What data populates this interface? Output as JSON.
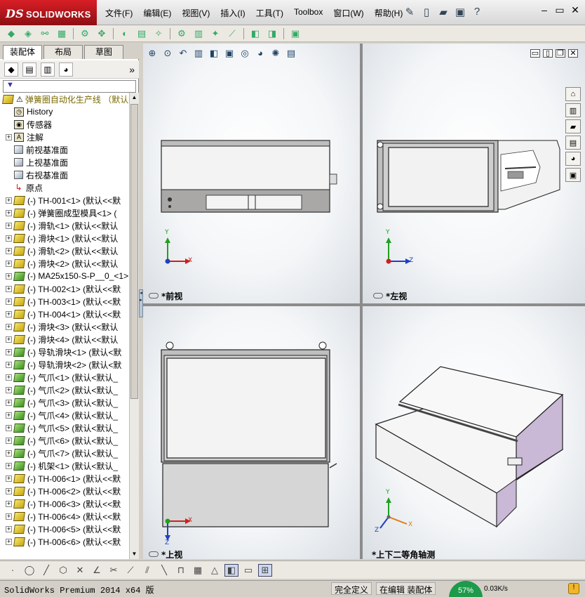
{
  "app": {
    "brand": "SOLIDWORKS",
    "brand_prefix": "DS"
  },
  "menu": [
    {
      "label": "文件(F)"
    },
    {
      "label": "编辑(E)"
    },
    {
      "label": "视图(V)"
    },
    {
      "label": "插入(I)"
    },
    {
      "label": "工具(T)"
    },
    {
      "label": "Toolbox"
    },
    {
      "label": "窗口(W)"
    },
    {
      "label": "帮助(H)"
    }
  ],
  "left_panel": {
    "tabs": [
      {
        "label": "装配体",
        "active": true
      },
      {
        "label": "布局",
        "active": false
      },
      {
        "label": "草图",
        "active": false
      }
    ],
    "filter_icon": "funnel-icon"
  },
  "tree": {
    "root": {
      "label": "弹簧圈自动化生产线 （默认"
    },
    "items": [
      {
        "label": "History",
        "icon": "history",
        "expand": false
      },
      {
        "label": "传感器",
        "icon": "sensor",
        "expand": false
      },
      {
        "label": "注解",
        "icon": "annotation",
        "expand": true
      },
      {
        "label": "前视基准面",
        "icon": "plane",
        "expand": false
      },
      {
        "label": "上视基准面",
        "icon": "plane",
        "expand": false
      },
      {
        "label": "右视基准面",
        "icon": "plane",
        "expand": false
      },
      {
        "label": "原点",
        "icon": "origin",
        "expand": false
      },
      {
        "label": "(-) TH-001<1> (默认<<默",
        "icon": "part",
        "expand": true
      },
      {
        "label": "(-) 弹簧圈成型模具<1> (",
        "icon": "part",
        "expand": true
      },
      {
        "label": "(-) 滑轨<1> (默认<<默认",
        "icon": "part",
        "expand": true
      },
      {
        "label": "(-) 滑块<1> (默认<<默认",
        "icon": "part",
        "expand": true
      },
      {
        "label": "(-) 滑轨<2> (默认<<默认",
        "icon": "part",
        "expand": true
      },
      {
        "label": "(-) 滑块<2> (默认<<默认",
        "icon": "part",
        "expand": true
      },
      {
        "label": "(-) MA25x150-S-P__0_<1>",
        "icon": "part-green",
        "expand": true
      },
      {
        "label": "(-) TH-002<1> (默认<<默",
        "icon": "part",
        "expand": true
      },
      {
        "label": "(-) TH-003<1> (默认<<默",
        "icon": "part",
        "expand": true
      },
      {
        "label": "(-) TH-004<1> (默认<<默",
        "icon": "part",
        "expand": true
      },
      {
        "label": "(-) 滑块<3> (默认<<默认",
        "icon": "part",
        "expand": true
      },
      {
        "label": "(-) 滑块<4> (默认<<默认",
        "icon": "part",
        "expand": true
      },
      {
        "label": "(-) 导轨滑块<1> (默认<默",
        "icon": "part-green",
        "expand": true
      },
      {
        "label": "(-) 导轨滑块<2> (默认<默",
        "icon": "part-green",
        "expand": true
      },
      {
        "label": "(-) 气爪<1> (默认<默认_",
        "icon": "part-green",
        "expand": true
      },
      {
        "label": "(-) 气爪<2> (默认<默认_",
        "icon": "part-green",
        "expand": true
      },
      {
        "label": "(-) 气爪<3> (默认<默认_",
        "icon": "part-green",
        "expand": true
      },
      {
        "label": "(-) 气爪<4> (默认<默认_",
        "icon": "part-green",
        "expand": true
      },
      {
        "label": "(-) 气爪<5> (默认<默认_",
        "icon": "part-green",
        "expand": true
      },
      {
        "label": "(-) 气爪<6> (默认<默认_",
        "icon": "part-green",
        "expand": true
      },
      {
        "label": "(-) 气爪<7> (默认<默认_",
        "icon": "part-green",
        "expand": true
      },
      {
        "label": "(-) 机架<1> (默认<默认_",
        "icon": "part-green",
        "expand": true
      },
      {
        "label": "(-) TH-006<1> (默认<<默",
        "icon": "part",
        "expand": true
      },
      {
        "label": "(-) TH-006<2> (默认<<默",
        "icon": "part",
        "expand": true
      },
      {
        "label": "(-) TH-006<3> (默认<<默",
        "icon": "part",
        "expand": true
      },
      {
        "label": "(-) TH-006<4> (默认<<默",
        "icon": "part",
        "expand": true
      },
      {
        "label": "(-) TH-006<5> (默认<<默",
        "icon": "part",
        "expand": true
      },
      {
        "label": "(-) TH-006<6> (默认<<默",
        "icon": "part",
        "expand": true
      }
    ]
  },
  "views": [
    {
      "label": "*前视"
    },
    {
      "label": "*左视"
    },
    {
      "label": "*上视"
    },
    {
      "label": "*上下二等角轴测"
    }
  ],
  "triad": {
    "x": "X",
    "y": "Y",
    "z": "Z"
  },
  "status": {
    "app_version": "SolidWorks Premium 2014 x64 版",
    "definition": "完全定义",
    "mode": "在编辑 装配体",
    "gauge": "57%",
    "net_speed": "0.03K/s"
  },
  "colors": {
    "brand_red": "#d81f26",
    "part_yellow": "#e4c42a",
    "model_gray": "#aaa9a8",
    "model_white": "#f4f4f4",
    "axis_x": "#cc2020",
    "axis_y": "#20a020",
    "axis_z": "#2040c0"
  }
}
